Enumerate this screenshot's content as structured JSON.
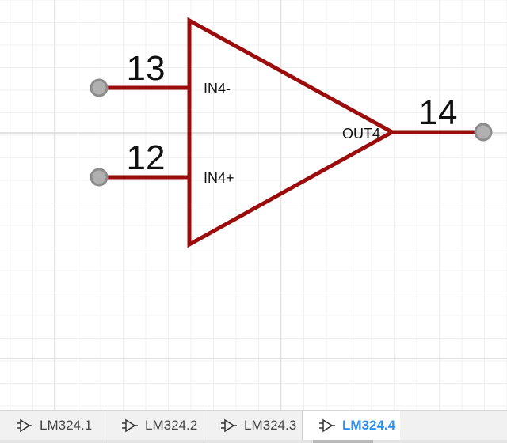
{
  "schematic": {
    "pins": [
      {
        "number": "13",
        "name": "IN4-"
      },
      {
        "number": "12",
        "name": "IN4+"
      },
      {
        "number": "14",
        "name": "OUT4"
      }
    ],
    "colors": {
      "body": "#9b0d0d",
      "grid_minor": "#f0f0f0",
      "grid_major": "#d2d2d2",
      "pin_end": "#b0b0b0"
    }
  },
  "tabs": [
    {
      "label": "LM324.1",
      "icon": "opamp-icon",
      "active": false
    },
    {
      "label": "LM324.2",
      "icon": "opamp-icon",
      "active": false
    },
    {
      "label": "LM324.3",
      "icon": "opamp-icon",
      "active": false
    },
    {
      "label": "LM324.4",
      "icon": "opamp-icon",
      "active": true
    }
  ]
}
